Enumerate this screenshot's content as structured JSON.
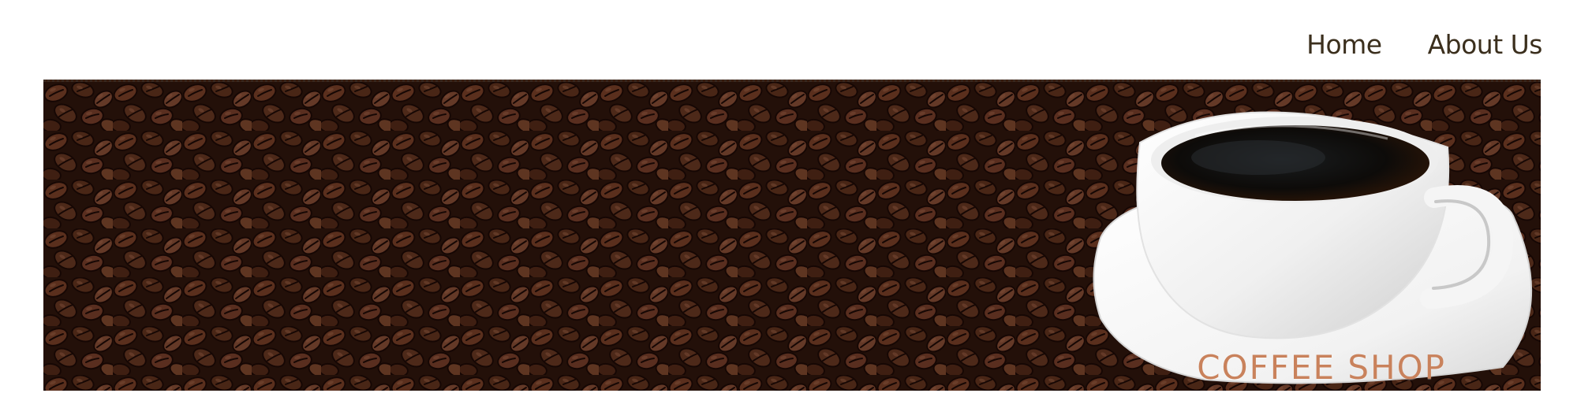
{
  "nav": {
    "items": [
      {
        "label": "Home"
      },
      {
        "label": "About Us"
      }
    ]
  },
  "hero": {
    "title": "COFFEE SHOP",
    "image_subject": "coffee cup on saucer over coffee beans"
  },
  "colors": {
    "nav_text": "#3b2f1d",
    "hero_title": "#c9825c",
    "bean_dark": "#2b140b",
    "bean_mid": "#5a2f1c",
    "bean_light": "#7b4630"
  }
}
